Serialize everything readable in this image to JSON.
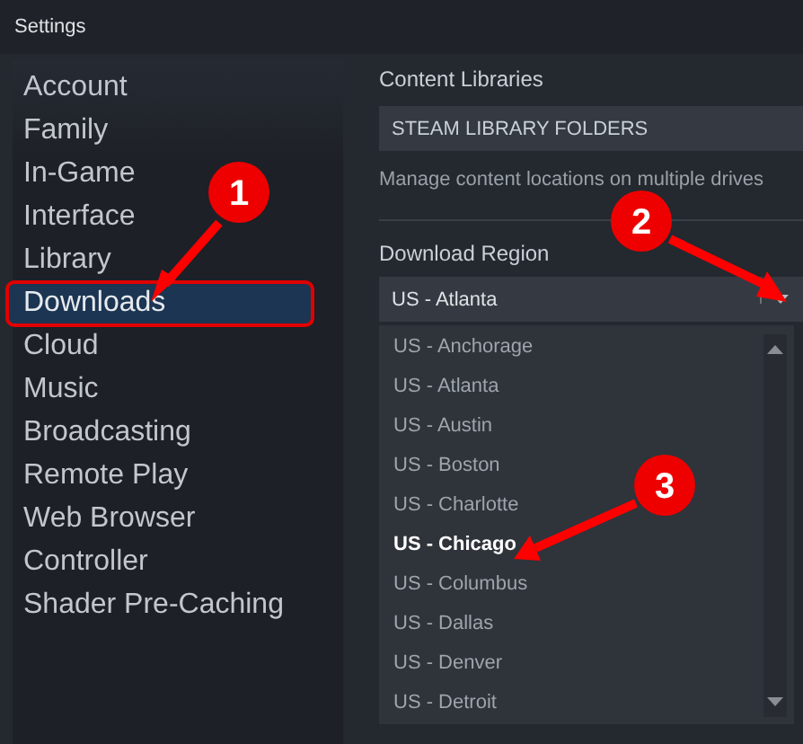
{
  "window": {
    "title": "Settings"
  },
  "sidebar": {
    "items": [
      {
        "label": "Account",
        "selected": false,
        "outlined": false
      },
      {
        "label": "Family",
        "selected": false,
        "outlined": false
      },
      {
        "label": "In-Game",
        "selected": false,
        "outlined": false
      },
      {
        "label": "Interface",
        "selected": false,
        "outlined": false
      },
      {
        "label": "Library",
        "selected": false,
        "outlined": false
      },
      {
        "label": "Downloads",
        "selected": true,
        "outlined": true
      },
      {
        "label": "Cloud",
        "selected": false,
        "outlined": false
      },
      {
        "label": "Music",
        "selected": false,
        "outlined": false
      },
      {
        "label": "Broadcasting",
        "selected": false,
        "outlined": false
      },
      {
        "label": "Remote Play",
        "selected": false,
        "outlined": false
      },
      {
        "label": "Web Browser",
        "selected": false,
        "outlined": false
      },
      {
        "label": "Controller",
        "selected": false,
        "outlined": false
      },
      {
        "label": "Shader Pre-Caching",
        "selected": false,
        "outlined": false
      }
    ]
  },
  "content_libraries": {
    "heading": "Content Libraries",
    "button": "STEAM LIBRARY FOLDERS",
    "description": "Manage content locations on multiple drives"
  },
  "download_region": {
    "heading": "Download Region",
    "value": "US - Atlanta",
    "expanded": true,
    "options": [
      {
        "label": "US - Anchorage",
        "highlighted": false
      },
      {
        "label": "US - Atlanta",
        "highlighted": false
      },
      {
        "label": "US - Austin",
        "highlighted": false
      },
      {
        "label": "US - Boston",
        "highlighted": false
      },
      {
        "label": "US - Charlotte",
        "highlighted": false
      },
      {
        "label": "US - Chicago",
        "highlighted": true
      },
      {
        "label": "US - Columbus",
        "highlighted": false
      },
      {
        "label": "US - Dallas",
        "highlighted": false
      },
      {
        "label": "US - Denver",
        "highlighted": false
      },
      {
        "label": "US - Detroit",
        "highlighted": false
      }
    ]
  },
  "annotations": [
    {
      "label": "1"
    },
    {
      "label": "2"
    },
    {
      "label": "3"
    }
  ]
}
